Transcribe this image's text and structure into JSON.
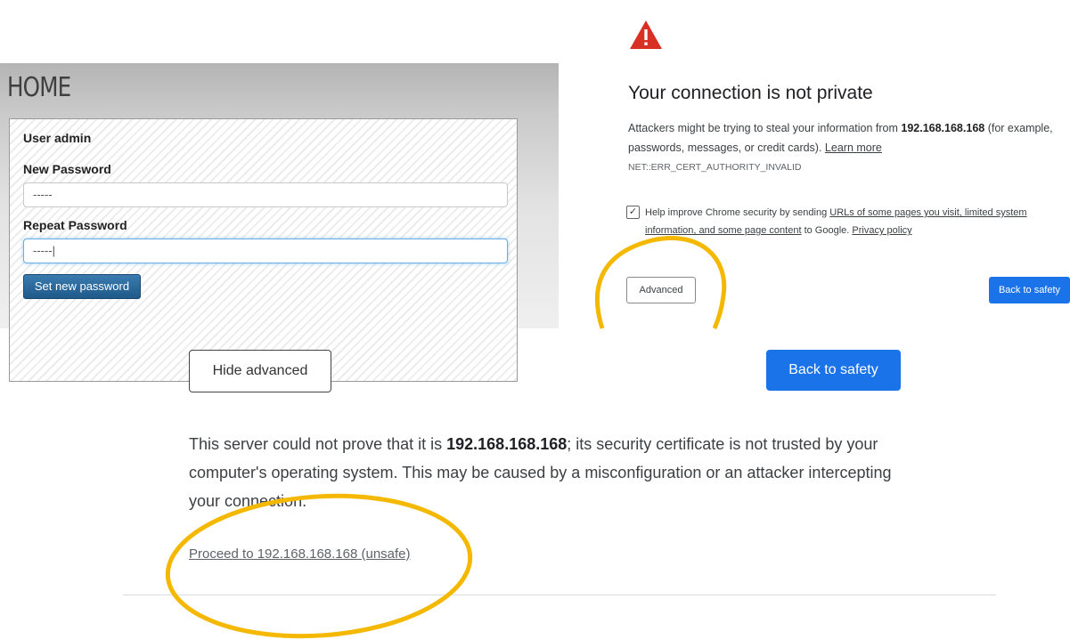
{
  "router": {
    "title": "HOME",
    "user_label": "User admin",
    "new_password_label": "New Password",
    "new_password_value": "-----",
    "repeat_password_label": "Repeat Password",
    "repeat_password_value": "-----|",
    "submit_label": "Set new password",
    "accent_color": "#205a8a"
  },
  "warning": {
    "icon": "warning-triangle-icon",
    "icon_color": "#d93025",
    "title": "Your connection is not private",
    "desc_prefix": "Attackers might be trying to steal your information from ",
    "host": "192.168.168.168",
    "desc_suffix": " (for example, passwords, messages, or credit cards). ",
    "learn_more": "Learn more",
    "error_code": "NET::ERR_CERT_AUTHORITY_INVALID",
    "checkbox_checked": true,
    "help_prefix": "Help improve Chrome security by sending ",
    "help_link": "URLs of some pages you visit, limited system information, and some page content",
    "help_middle": " to Google. ",
    "privacy_link": "Privacy policy",
    "advanced_button": "Advanced",
    "back_button": "Back to safety"
  },
  "advanced": {
    "hide_button": "Hide advanced",
    "back_button": "Back to safety",
    "text_prefix": "This server could not prove that it is ",
    "host": "192.168.168.168",
    "text_suffix": "; its security certificate is not trusted by your computer's operating system. This may be caused by a misconfiguration or an attacker intercepting your connection.",
    "proceed_link": "Proceed to 192.168.168.168 (unsafe)"
  },
  "highlight_color": "#f5b800"
}
